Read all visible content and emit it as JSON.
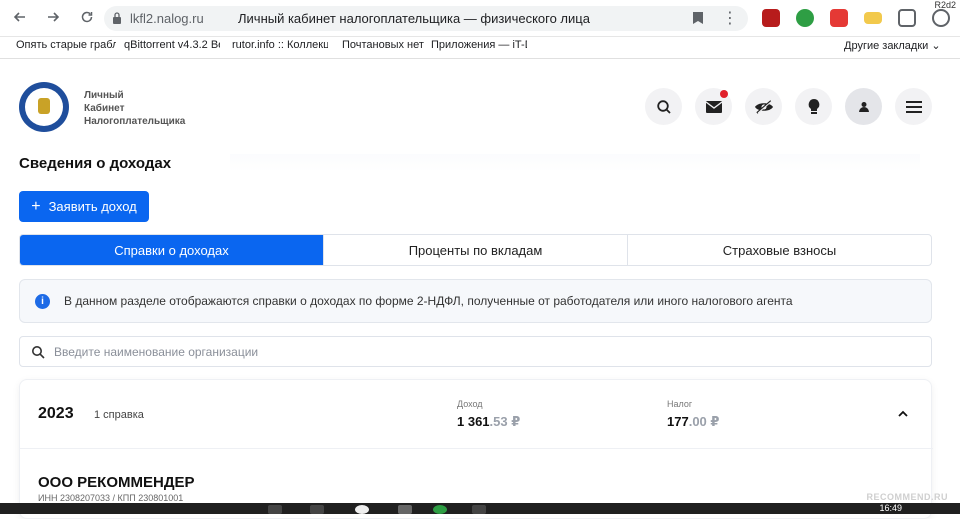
{
  "browser": {
    "domain": "lkfl2.nalog.ru",
    "tab_title": "Личный кабинет налогоплательщика — физического лица",
    "corner_label": "R2d2",
    "bookmarks": [
      "Опять старые граблі",
      "qBittorrent v4.3.2 Be",
      "rutor.info :: Коллекц",
      "Почтановых нет",
      "Приложения — iT-D"
    ],
    "other_bookmarks": "Другие закладки"
  },
  "header": {
    "brand_line1": "Личный",
    "brand_line2": "Кабинет",
    "brand_line3": "Налогоплательщика"
  },
  "main": {
    "title": "Сведения о доходах",
    "declare_button": "Заявить доход",
    "tabs": [
      {
        "label": "Справки о доходах",
        "active": true
      },
      {
        "label": "Проценты по вкладам",
        "active": false
      },
      {
        "label": "Страховые взносы",
        "active": false
      }
    ],
    "info_text": "В данном разделе отображаются справки о доходах по форме 2-НДФЛ, полученные от работодателя или иного налогового агента",
    "search_placeholder": "Введите наименование организации"
  },
  "card": {
    "year": "2023",
    "count": "1 справка",
    "income_label": "Доход",
    "income_int": "1 361",
    "income_dec": ".53 ₽",
    "tax_label": "Налог",
    "tax_int": "177",
    "tax_dec": ".00 ₽",
    "org_name": "ООО РЕКОММЕНДЕР",
    "org_ids": "ИНН 2308207033 / КПП 230801001"
  },
  "taskbar": {
    "time": "16:49"
  },
  "watermark": "RECOMMEND.RU",
  "colors": {
    "accent": "#0a66f0",
    "notification": "#e0202a"
  }
}
